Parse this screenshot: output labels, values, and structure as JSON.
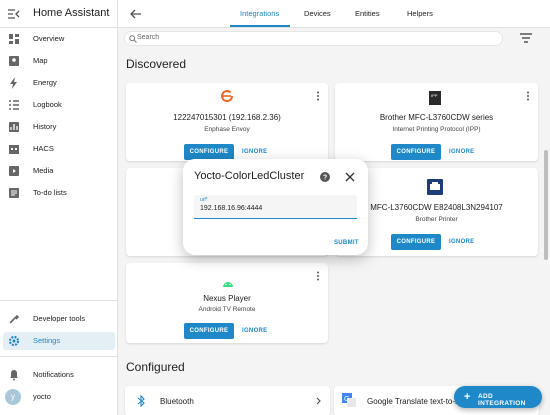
{
  "app": {
    "title": "Home Assistant"
  },
  "sidebar": {
    "items": [
      {
        "label": "Overview",
        "icon": "dashboard-icon"
      },
      {
        "label": "Map",
        "icon": "map-icon"
      },
      {
        "label": "Energy",
        "icon": "energy-icon"
      },
      {
        "label": "Logbook",
        "icon": "logbook-icon"
      },
      {
        "label": "History",
        "icon": "history-icon"
      },
      {
        "label": "HACS",
        "icon": "hacs-icon"
      },
      {
        "label": "Media",
        "icon": "media-icon"
      },
      {
        "label": "To-do lists",
        "icon": "todo-icon"
      }
    ],
    "bottom": [
      {
        "label": "Developer tools",
        "icon": "developer-tools-icon"
      },
      {
        "label": "Settings",
        "icon": "settings-icon",
        "active": true
      },
      {
        "label": "Notifications",
        "icon": "bell-icon"
      },
      {
        "label": "yocto",
        "avatar_letter": "y"
      }
    ]
  },
  "tabs": [
    {
      "label": "Integrations",
      "active": true
    },
    {
      "label": "Devices"
    },
    {
      "label": "Entities"
    },
    {
      "label": "Helpers"
    }
  ],
  "search": {
    "placeholder": "Search"
  },
  "discovered": {
    "title": "Discovered",
    "cards": [
      {
        "name": "122247015301 (192.168.2.36)",
        "sub": "Enphase Envoy",
        "configure": "CONFIGURE",
        "ignore": "IGNORE"
      },
      {
        "name": "Brother MFC-L3760CDW series",
        "sub": "Internet Printing Protocol (IPP)",
        "configure": "CONFIGURE",
        "ignore": "IGNORE"
      },
      {
        "name": "MFC-L3760CDW E82408L3N294107",
        "sub": "Brother Printer",
        "configure": "CONFIGURE",
        "ignore": "IGNORE"
      },
      {
        "name": "Nexus Player",
        "sub": "Android TV Remote",
        "configure": "CONFIGURE",
        "ignore": "IGNORE"
      }
    ]
  },
  "dialog": {
    "title": "Yocto-ColorLedCluster",
    "field_label": "url*",
    "field_value": "192.168.16.96:4444",
    "submit": "SUBMIT"
  },
  "configured": {
    "title": "Configured",
    "cards": [
      {
        "name": "Bluetooth"
      },
      {
        "name": "Google Translate text-to-sp"
      }
    ]
  },
  "fab": {
    "label": "ADD INTEGRATION"
  },
  "colors": {
    "accent": "#1e88c8",
    "enphase": "#f26522"
  }
}
